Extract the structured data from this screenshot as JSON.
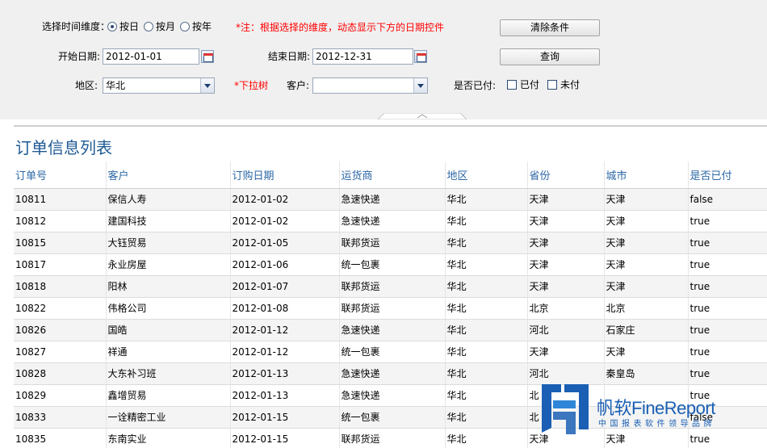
{
  "params": {
    "dimension_label": "选择时间维度：",
    "radios": [
      {
        "label": "按日",
        "selected": true
      },
      {
        "label": "按月",
        "selected": false
      },
      {
        "label": "按年",
        "selected": false
      }
    ],
    "note": "*注：根据选择的维度，动态显示下方的日期控件",
    "start_label": "开始日期:",
    "start_value": "2012-01-01",
    "end_label": "结束日期:",
    "end_value": "2012-12-31",
    "region_label": "地区:",
    "region_value": "华北",
    "tree_note": "*下拉树",
    "customer_label": "客户:",
    "customer_value": "",
    "paid_label": "是否已付:",
    "paid_options": [
      {
        "label": "已付",
        "checked": false
      },
      {
        "label": "未付",
        "checked": false
      }
    ],
    "clear_button": "清除条件",
    "query_button": "查询"
  },
  "report": {
    "title": "订单信息列表",
    "columns": [
      "订单号",
      "客户",
      "订购日期",
      "运货商",
      "地区",
      "省份",
      "城市",
      "是否已付"
    ],
    "rows": [
      [
        "10811",
        "保信人寿",
        "2012-01-02",
        "急速快递",
        "华北",
        "天津",
        "天津",
        "false"
      ],
      [
        "10812",
        "建国科技",
        "2012-01-02",
        "急速快递",
        "华北",
        "天津",
        "天津",
        "true"
      ],
      [
        "10815",
        "大钰贸易",
        "2012-01-05",
        "联邦货运",
        "华北",
        "天津",
        "天津",
        "true"
      ],
      [
        "10817",
        "永业房屋",
        "2012-01-06",
        "统一包裹",
        "华北",
        "天津",
        "天津",
        "true"
      ],
      [
        "10818",
        "阳林",
        "2012-01-07",
        "联邦货运",
        "华北",
        "天津",
        "天津",
        "true"
      ],
      [
        "10822",
        "伟格公司",
        "2012-01-08",
        "联邦货运",
        "华北",
        "北京",
        "北京",
        "true"
      ],
      [
        "10826",
        "国皓",
        "2012-01-12",
        "急速快递",
        "华北",
        "河北",
        "石家庄",
        "true"
      ],
      [
        "10827",
        "祥通",
        "2012-01-12",
        "统一包裹",
        "华北",
        "天津",
        "天津",
        "true"
      ],
      [
        "10828",
        "大东补习班",
        "2012-01-13",
        "急速快递",
        "华北",
        "河北",
        "秦皇岛",
        "true"
      ],
      [
        "10829",
        "鑫增贸易",
        "2012-01-13",
        "急速快递",
        "华北",
        "北",
        "",
        "true"
      ],
      [
        "10833",
        "一诠精密工业",
        "2012-01-15",
        "统一包裹",
        "华北",
        "北",
        "",
        "false"
      ],
      [
        "10835",
        "东南实业",
        "2012-01-15",
        "联邦货运",
        "华北",
        "天津",
        "天津",
        "true"
      ]
    ]
  },
  "watermark": {
    "brand": "帆软FineReport",
    "tagline": "中国报表软件领导品牌",
    "color": "#1a5fb4"
  }
}
